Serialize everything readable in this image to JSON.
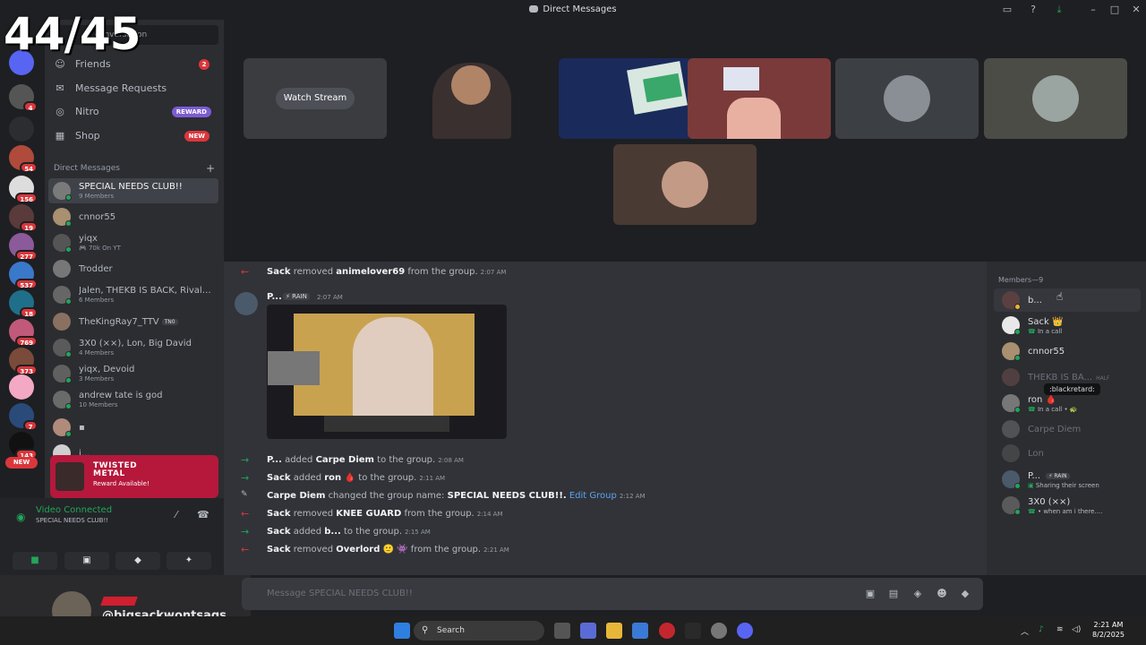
{
  "window": {
    "title": "Direct Messages"
  },
  "overlay": {
    "counter": "44/45",
    "handle": "@bigsackwontsags"
  },
  "servers": {
    "badges": [
      "4",
      "54",
      "156",
      "19",
      "277",
      "537",
      "18",
      "769",
      "373",
      "7",
      "143"
    ],
    "new_label": "NEW"
  },
  "sidebar": {
    "search_placeholder": "conversation",
    "nav": [
      {
        "label": "Friends",
        "badge": "2",
        "icon": "friends-icon"
      },
      {
        "label": "Message Requests",
        "icon": "mail-icon"
      },
      {
        "label": "Nitro",
        "badge": "REWARD",
        "icon": "nitro-icon"
      },
      {
        "label": "Shop",
        "badge": "NEW",
        "icon": "shop-icon"
      }
    ],
    "dm_header": "Direct Messages",
    "dm_add": "+",
    "dms": [
      {
        "name": "SPECIAL NEEDS CLUB!!",
        "sub": "9 Members"
      },
      {
        "name": "cnnor55"
      },
      {
        "name": "yiqx",
        "sub": "70k On YT"
      },
      {
        "name": "Trodder"
      },
      {
        "name": "Jalen, THEKB IS BACK, Rivals...",
        "sub": "6 Members"
      },
      {
        "name": "TheKingRay7_TTV",
        "tag": "TN0"
      },
      {
        "name": "3X0 (××), Lon, Big David",
        "sub": "4 Members"
      },
      {
        "name": "yiqx, Devoid",
        "sub": "3 Members"
      },
      {
        "name": "andrew tate is god",
        "sub": "10 Members"
      },
      {
        "name": ""
      },
      {
        "name": "i..."
      }
    ],
    "promo": {
      "logo_line1": "TWISTED",
      "logo_line2": "METAL",
      "text": "Reward Available!"
    },
    "voice": {
      "status": "Video Connected",
      "channel": "SPECIAL NEEDS CLUB!!"
    }
  },
  "call": {
    "watch_stream": "Watch Stream"
  },
  "messages": {
    "system_top": {
      "actor": "Sack",
      "verb": "removed",
      "target": "animelover69",
      "rest": "from the group.",
      "time": "2:07 AM"
    },
    "post": {
      "author": "P...",
      "tag": "⚡ RAIN",
      "time": "2:07 AM"
    },
    "events": [
      {
        "type": "in",
        "actor": "P...",
        "verb": "added",
        "target": "Carpe Diem",
        "rest": "to the group.",
        "time": "2:08 AM"
      },
      {
        "type": "in",
        "actor": "Sack",
        "verb": "added",
        "target": "ron 🩸",
        "rest": "to the group.",
        "time": "2:11 AM"
      },
      {
        "type": "pen",
        "actor": "Carpe Diem",
        "verb": "changed the group name:",
        "target": "SPECIAL NEEDS CLUB!!.",
        "link": "Edit Group",
        "time": "2:12 AM"
      },
      {
        "type": "out",
        "actor": "Sack",
        "verb": "removed",
        "target": "KNEE GUARD",
        "rest": "from the group.",
        "time": "2:14 AM"
      },
      {
        "type": "in",
        "actor": "Sack",
        "verb": "added",
        "target": "b...",
        "rest": "to the group.",
        "time": "2:15 AM"
      },
      {
        "type": "out",
        "actor": "Sack",
        "verb": "removed",
        "target": "Overlord",
        "rest": "🙂 👾 from the group.",
        "time": "2:21 AM"
      }
    ],
    "composer_placeholder": "Message SPECIAL NEEDS CLUB!!"
  },
  "members": {
    "header": "Members—9",
    "list": [
      {
        "name": "b..."
      },
      {
        "name": "Sack 👑",
        "sub": "In a call"
      },
      {
        "name": "cnnor55"
      },
      {
        "name": "THEKB IS BA...",
        "tag": "HALF",
        "dim": true
      },
      {
        "name": "ron 🩸",
        "sub": "In a call • 🐢"
      },
      {
        "name": "Carpe Diem",
        "dim": true
      },
      {
        "name": "Lon",
        "dim": true
      },
      {
        "name": "P...",
        "tag": "⚡ RAIN",
        "sub": "Sharing their screen"
      },
      {
        "name": "3X0 (××)",
        "sub": "• when am i there...."
      }
    ],
    "tooltip": ":blackretard:"
  },
  "taskbar": {
    "search": "Search",
    "time": "2:21 AM",
    "date": "8/2/2025"
  }
}
